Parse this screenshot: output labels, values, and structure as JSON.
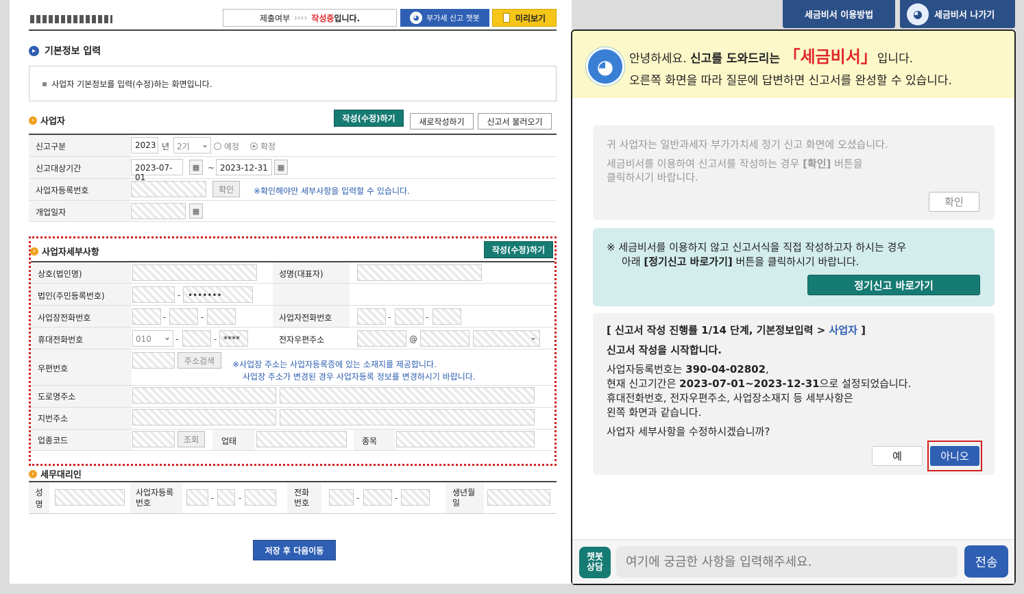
{
  "topbar": {
    "status_label": "제출여부",
    "status_arrows": "››››",
    "status_value": "작성중",
    "status_suffix": "입니다.",
    "chatbot_btn": "부가세 신고 챗봇",
    "preview_btn": "미리보기"
  },
  "right_tabs": {
    "howto": "세금비서 이용방법",
    "exit": "세금비서 나가기"
  },
  "section": {
    "title": "기본정보 입력",
    "desc": "사업자 기본정보를 입력(수정)하는 화면입니다."
  },
  "business": {
    "title": "사업자",
    "edit_btn": "작성(수정)하기",
    "new_btn": "새로작성하기",
    "load_btn": "신고서 불러오기",
    "rows": {
      "report_type_label": "신고구분",
      "year": "2023",
      "year_unit": "년",
      "period": "2기",
      "opt_planned": "예정",
      "opt_final": "확정",
      "period_label": "신고대상기간",
      "date_from": "2023-07-01",
      "date_sep": "~",
      "date_to": "2023-12-31",
      "bizno_label": "사업자등록번호",
      "confirm_btn": "확인",
      "bizno_note": "※확인해야만 세부사항을 입력할 수 있습니다.",
      "open_label": "개업일자"
    }
  },
  "details": {
    "title": "사업자세부사항",
    "edit_btn": "작성(수정)하기",
    "company_label": "상호(법인명)",
    "ceo_label": "성명(대표자)",
    "corp_label": "법인(주민등록번호)",
    "masked": "•••••••",
    "phone_label": "사업장전화번호",
    "phone2_label": "사업자전화번호",
    "mobile_label": "휴대전화번호",
    "mobile_prefix": "010",
    "mobile_mask": "****",
    "email_label": "전자우편주소",
    "email_at": "@",
    "zip_label": "우편번호",
    "addr_search_btn": "주소검색",
    "addr_note1": "※사업장 주소는 사업자등록증에 있는 소재지를 제공합니다.",
    "addr_note2": "사업장 주소가 변경된 경우 사업자등록 정보를 변경하시기 바랍니다.",
    "road_label": "도로명주소",
    "lot_label": "지번주소",
    "industry_label": "업종코드",
    "lookup_btn": "조회",
    "biz_type_label": "업태",
    "item_label": "종목"
  },
  "agent": {
    "title": "세무대리인",
    "name_label": "성명",
    "bizno_label": "사업자등록번호",
    "phone_label": "전화번호",
    "birth_label": "생년월일"
  },
  "save_btn": "저장 후 다음이동",
  "chat": {
    "greet_pre": "안녕하세요.",
    "greet_bold": "신고를 도와드리는",
    "brand": "「세금비서」",
    "greet_post": "입니다.",
    "greet_line2": "오른쪽 화면을 따라 질문에 답변하면 신고서를 완성할 수 있습니다.",
    "msg1_line1": "귀 사업자는 일반과세자 부가가치세 정기 신고 화면에 오셨습니다.",
    "msg1_line2_pre": "세금비서를 이용하여 신고서를 작성하는 경우",
    "msg1_line2_bold": "[확인]",
    "msg1_line2_post": "버튼을",
    "msg1_line3": "클릭하시기 바랍니다.",
    "msg1_btn": "확인",
    "msg2_line1": "※ 세금비서를 이용하지 않고 신고서식을 직접 작성하고자 하시는 경우",
    "msg2_line2_pre": "아래",
    "msg2_line2_bold": "[정기신고 바로가기]",
    "msg2_line2_post": "버튼을 클릭하시기 바랍니다.",
    "msg2_btn": "정기신고 바로가기",
    "msg3_head_pre": "[ 신고서 작성 진행률 1/14 단계, 기본정보입력 >",
    "msg3_head_link": "사업자",
    "msg3_head_post": "]",
    "msg3_start": "신고서 작성을 시작합니다.",
    "msg3_l1_pre": "사업자등록번호는",
    "msg3_l1_bold": "390-04-02802",
    "msg3_l1_post": ",",
    "msg3_l2_pre": "현재 신고기간은",
    "msg3_l2_bold": "2023-07-01~2023-12-31",
    "msg3_l2_post": "으로 설정되었습니다.",
    "msg3_l3": "휴대전화번호, 전자우편주소, 사업장소재지 등 세부사항은",
    "msg3_l4": "왼쪽 화면과 같습니다.",
    "msg3_q": "사업자 세부사항을 수정하시겠습니까?",
    "yes_btn": "예",
    "no_btn": "아니오",
    "chatbot_badge_1": "챗봇",
    "chatbot_badge_2": "상담",
    "input_placeholder": "여기에 궁금한 사항을 입력해주세요.",
    "send_btn": "전송"
  },
  "colors": {
    "teal": "#167b73",
    "blue": "#2f5fb3",
    "red": "#e0262a",
    "yellow": "#fdf8c9"
  }
}
